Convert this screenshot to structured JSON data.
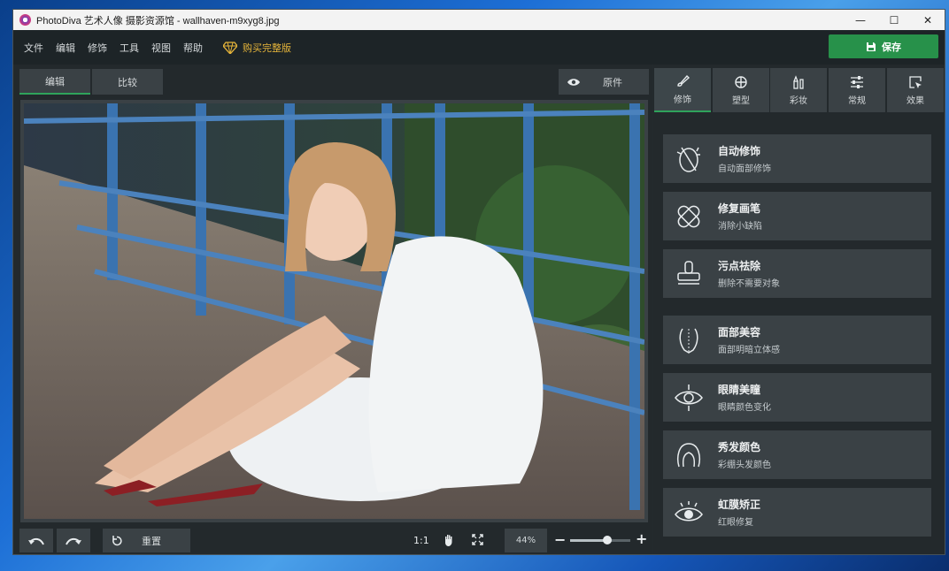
{
  "window": {
    "title": "PhotoDiva 艺术人像 摄影资源馆 - wallhaven-m9xyg8.jpg"
  },
  "menu": [
    "文件",
    "编辑",
    "修饰",
    "工具",
    "视图",
    "帮助"
  ],
  "buy_label": "购买完整版",
  "save_label": "保存",
  "view_tabs": {
    "edit": "编辑",
    "compare": "比较"
  },
  "original_label": "原件",
  "bottom": {
    "reset": "重置",
    "ratio": "1:1",
    "zoom": "44%",
    "zoom_level": 0.62
  },
  "right_tabs": [
    "修饰",
    "塑型",
    "彩妆",
    "常规",
    "效果"
  ],
  "tools": [
    {
      "title": "自动修饰",
      "sub": "自动面部修饰"
    },
    {
      "title": "修复画笔",
      "sub": "消除小缺陷"
    },
    {
      "title": "污点祛除",
      "sub": "删除不需要对象"
    },
    {
      "title": "面部美容",
      "sub": "面部明暗立体感"
    },
    {
      "title": "眼睛美瞳",
      "sub": "眼睛颜色变化"
    },
    {
      "title": "秀发颜色",
      "sub": "彩绷头发颜色"
    },
    {
      "title": "虹膜矫正",
      "sub": "红眼修复"
    }
  ],
  "colors": {
    "accent": "#2fa35b",
    "save": "#27914a",
    "buy": "#e5b43a"
  }
}
